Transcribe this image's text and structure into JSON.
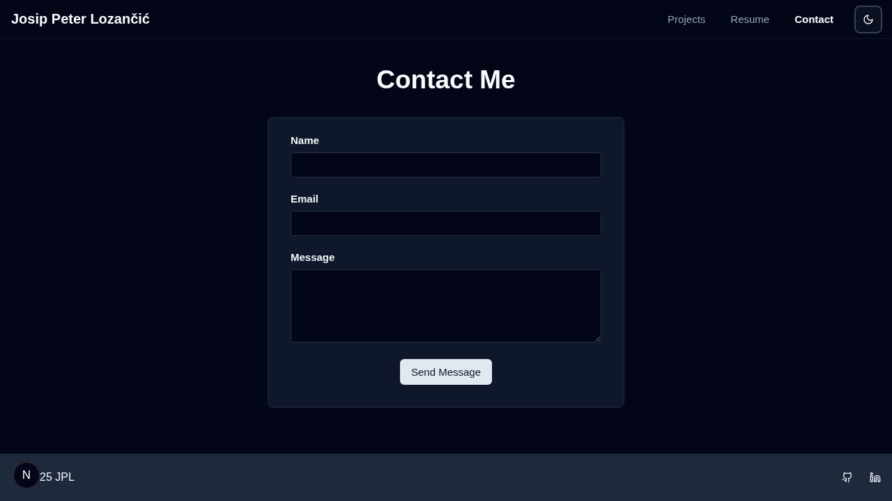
{
  "header": {
    "title": "Josip Peter Lozančić",
    "nav": [
      {
        "label": "Projects",
        "selected": false
      },
      {
        "label": "Resume",
        "selected": false
      },
      {
        "label": "Contact",
        "selected": true
      }
    ]
  },
  "heading": "Contact Me",
  "form": {
    "fields": [
      {
        "label": "Name",
        "kind": "input"
      },
      {
        "label": "Email",
        "kind": "input"
      },
      {
        "label": "Message",
        "kind": "textarea"
      }
    ],
    "submit": "Send Message"
  },
  "footer": {
    "copyright": "25 JPL",
    "badge": "N"
  }
}
